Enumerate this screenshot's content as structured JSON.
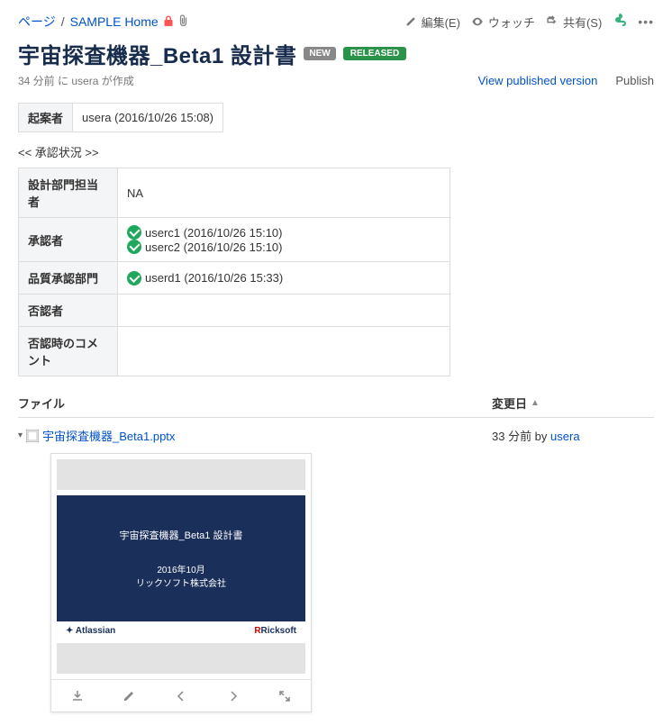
{
  "breadcrumbs": {
    "root": "ページ",
    "space": "SAMPLE Home"
  },
  "toolbar": {
    "edit": "編集(E)",
    "watch": "ウォッチ",
    "share": "共有(S)"
  },
  "page": {
    "title": "宇宙探査機器_Beta1 設計書",
    "badge_new": "NEW",
    "badge_released": "RELEASED",
    "byline": "34 分前 に usera が作成",
    "view_published": "View published version",
    "publish": "Publish"
  },
  "proposer": {
    "label": "起案者",
    "value": "usera (2016/10/26 15:08)"
  },
  "approval": {
    "heading": "<< 承認状況 >>",
    "rows": {
      "design_manager_label": "設計部門担当者",
      "design_manager_value": "NA",
      "approver_label": "承認者",
      "approver_userc1": "userc1 (2016/10/26 15:10)",
      "approver_userc2": "userc2 (2016/10/26 15:10)",
      "qa_label": "品質承認部門",
      "qa_userd1": "userd1 (2016/10/26 15:33)",
      "rejecter_label": "否認者",
      "reject_comment_label": "否認時のコメント"
    }
  },
  "files": {
    "col_file": "ファイル",
    "col_modified": "変更日",
    "name": "宇宙探査機器_Beta1.pptx",
    "modified_prefix": "33 分前 by ",
    "modified_user": "usera"
  },
  "preview": {
    "slide_title": "宇宙探査機器_Beta1 設計書",
    "slide_date_line1": "2016年10月",
    "slide_date_line2": "リックソフト株式会社",
    "logo_left": "Atlassian",
    "logo_right": "Ricksoft"
  }
}
